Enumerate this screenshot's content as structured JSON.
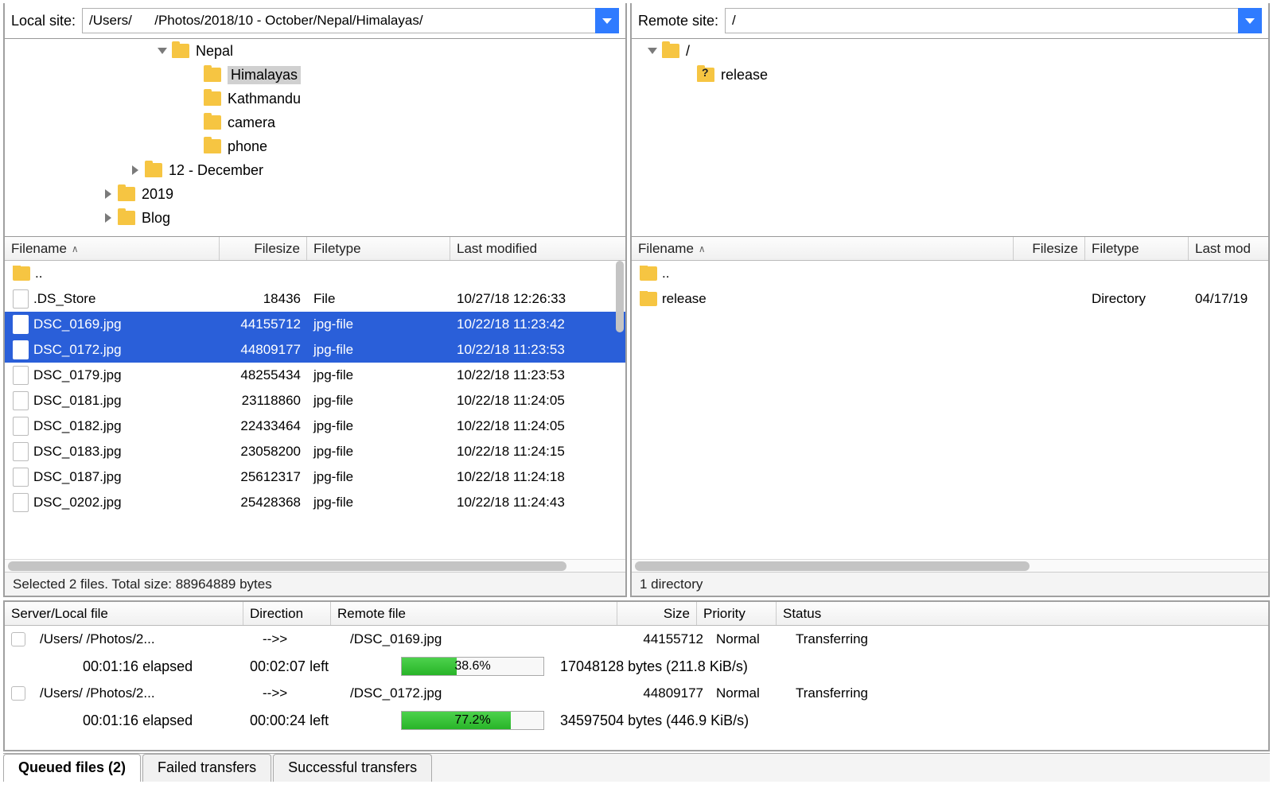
{
  "local": {
    "label": "Local site:",
    "path": "/Users/      /Photos/2018/10 - October/Nepal/Himalayas/",
    "tree": [
      {
        "indent": 190,
        "disc": "down",
        "name": "Nepal"
      },
      {
        "indent": 230,
        "disc": "",
        "name": "Himalayas",
        "selected": true
      },
      {
        "indent": 230,
        "disc": "",
        "name": "Kathmandu"
      },
      {
        "indent": 230,
        "disc": "",
        "name": "camera"
      },
      {
        "indent": 230,
        "disc": "",
        "name": "phone"
      },
      {
        "indent": 156,
        "disc": "right",
        "name": "12 - December"
      },
      {
        "indent": 122,
        "disc": "right",
        "name": "2019"
      },
      {
        "indent": 122,
        "disc": "right",
        "name": "Blog"
      }
    ],
    "headers": {
      "name": "Filename",
      "size": "Filesize",
      "type": "Filetype",
      "modified": "Last modified"
    },
    "files": [
      {
        "icon": "folder",
        "name": "..",
        "size": "",
        "type": "",
        "modified": ""
      },
      {
        "icon": "file",
        "name": ".DS_Store",
        "size": "18436",
        "type": "File",
        "modified": "10/27/18 12:26:33"
      },
      {
        "icon": "file",
        "name": "DSC_0169.jpg",
        "size": "44155712",
        "type": "jpg-file",
        "modified": "10/22/18 11:23:42",
        "selected": true
      },
      {
        "icon": "file",
        "name": "DSC_0172.jpg",
        "size": "44809177",
        "type": "jpg-file",
        "modified": "10/22/18 11:23:53",
        "selected": true
      },
      {
        "icon": "file",
        "name": "DSC_0179.jpg",
        "size": "48255434",
        "type": "jpg-file",
        "modified": "10/22/18 11:23:53"
      },
      {
        "icon": "file",
        "name": "DSC_0181.jpg",
        "size": "23118860",
        "type": "jpg-file",
        "modified": "10/22/18 11:24:05"
      },
      {
        "icon": "file",
        "name": "DSC_0182.jpg",
        "size": "22433464",
        "type": "jpg-file",
        "modified": "10/22/18 11:24:05"
      },
      {
        "icon": "file",
        "name": "DSC_0183.jpg",
        "size": "23058200",
        "type": "jpg-file",
        "modified": "10/22/18 11:24:15"
      },
      {
        "icon": "file",
        "name": "DSC_0187.jpg",
        "size": "25612317",
        "type": "jpg-file",
        "modified": "10/22/18 11:24:18"
      },
      {
        "icon": "file",
        "name": "DSC_0202.jpg",
        "size": "25428368",
        "type": "jpg-file",
        "modified": "10/22/18 11:24:43"
      }
    ],
    "status": "Selected 2 files. Total size: 88964889 bytes"
  },
  "remote": {
    "label": "Remote site:",
    "path": "/",
    "tree": [
      {
        "indent": 18,
        "disc": "down",
        "name": "/",
        "folder": "plain"
      },
      {
        "indent": 62,
        "disc": "",
        "name": "release",
        "folder": "question"
      }
    ],
    "headers": {
      "name": "Filename",
      "size": "Filesize",
      "type": "Filetype",
      "modified": "Last mod"
    },
    "files": [
      {
        "icon": "folder",
        "name": "..",
        "size": "",
        "type": "",
        "modified": ""
      },
      {
        "icon": "folder",
        "name": "release",
        "size": "",
        "type": "Directory",
        "modified": "04/17/19"
      }
    ],
    "status": "1 directory"
  },
  "transfers": {
    "headers": {
      "slf": "Server/Local file",
      "dir": "Direction",
      "rf": "Remote file",
      "sz": "Size",
      "pr": "Priority",
      "st": "Status"
    },
    "items": [
      {
        "local": "/Users/     /Photos/2...",
        "arrow": "-->>",
        "remote": "/DSC_0169.jpg",
        "size": "44155712",
        "priority": "Normal",
        "status": "Transferring",
        "elapsed": "00:01:16 elapsed",
        "left": "00:02:07 left",
        "pct_text": "38.6%",
        "pct": 38.6,
        "bytes": "17048128 bytes (211.8 KiB/s)"
      },
      {
        "local": "/Users/     /Photos/2...",
        "arrow": "-->>",
        "remote": "/DSC_0172.jpg",
        "size": "44809177",
        "priority": "Normal",
        "status": "Transferring",
        "elapsed": "00:01:16 elapsed",
        "left": "00:00:24 left",
        "pct_text": "77.2%",
        "pct": 77.2,
        "bytes": "34597504 bytes (446.9 KiB/s)"
      }
    ]
  },
  "tabs": {
    "queued": "Queued files (2)",
    "failed": "Failed transfers",
    "success": "Successful transfers"
  }
}
